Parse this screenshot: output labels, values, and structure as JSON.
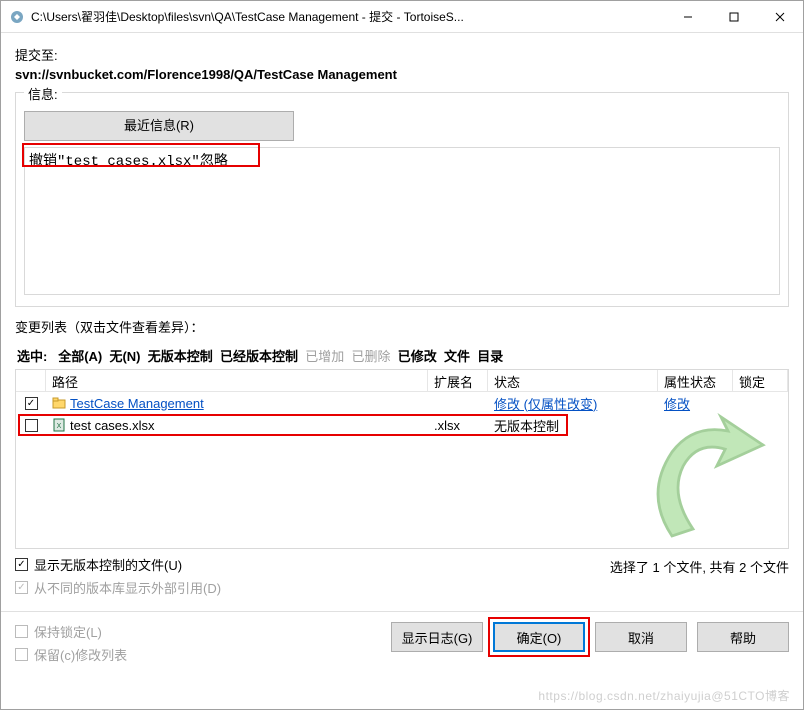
{
  "title": "C:\\Users\\翟羽佳\\Desktop\\files\\svn\\QA\\TestCase Management - 提交 - TortoiseS...",
  "submit_to_label": "提交至:",
  "svn_url": "svn://svnbucket.com/Florence1998/QA/TestCase Management",
  "info_group_title": "信息:",
  "recent_button": "最近信息(R)",
  "commit_message": "撤销\"test cases.xlsx\"忽略",
  "changes_label": "变更列表（双击文件查看差异）：",
  "filters": {
    "selected_label": "选中:",
    "all": "全部(A)",
    "none": "无(N)",
    "unversioned": "无版本控制",
    "versioned": "已经版本控制",
    "added": "已增加",
    "deleted": "已删除",
    "modified": "已修改",
    "files": "文件",
    "dirs": "目录"
  },
  "columns": {
    "path": "路径",
    "ext": "扩展名",
    "status": "状态",
    "prop_status": "属性状态",
    "lock": "锁定"
  },
  "rows": [
    {
      "checked": true,
      "icon": "folder",
      "path": "TestCase Management",
      "ext": "",
      "status": "修改 (仅属性改变)",
      "prop_status": "修改",
      "lock": "",
      "style": "blue-underline"
    },
    {
      "checked": false,
      "icon": "xlsx",
      "path": "test cases.xlsx",
      "ext": ".xlsx",
      "status": "无版本控制",
      "prop_status": "",
      "lock": "",
      "style": "normal"
    }
  ],
  "show_unversioned": "显示无版本控制的文件(U)",
  "show_externals": "从不同的版本库显示外部引用(D)",
  "selection_info": "选择了 1 个文件, 共有 2 个文件",
  "keep_locks": "保持锁定(L)",
  "keep_changelist": "保留(c)修改列表",
  "buttons": {
    "show_log": "显示日志(G)",
    "ok": "确定(O)",
    "cancel": "取消",
    "help": "帮助"
  },
  "watermark": "https://blog.csdn.net/zhaiyujia@51CTO博客"
}
